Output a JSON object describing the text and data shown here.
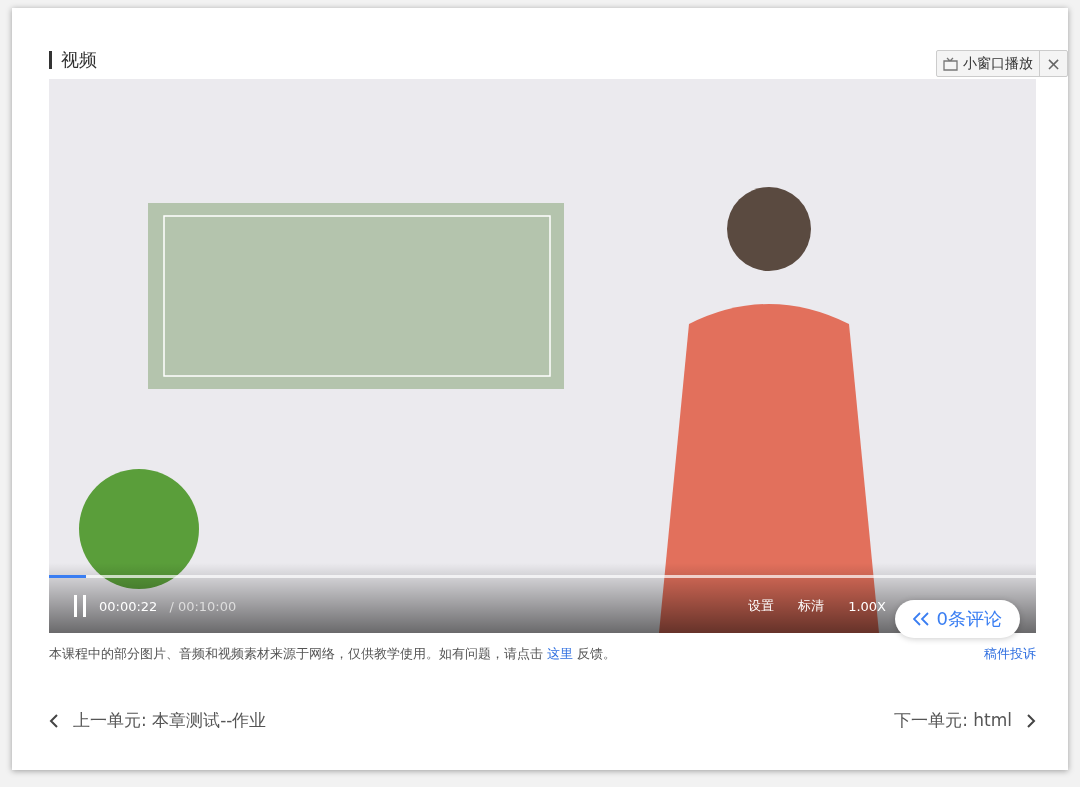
{
  "section_title": "视频",
  "mini_player": {
    "label": "小窗口播放",
    "close": "×"
  },
  "player": {
    "playing": true,
    "progress": {
      "level": 0.037
    },
    "current_time": "00:00:22",
    "duration": "/ 00:10:00",
    "settings": "设置",
    "quality": "标清",
    "speed": "1.00X"
  },
  "comments_button": {
    "label": "0条评论"
  },
  "notice": {
    "text_before": "本课程中的部分图片、音频和视频素材来源于网络，仅供教学使用。如有问题，请点击",
    "link": "这里",
    "text_after": "反馈。"
  },
  "report_link": "稿件投诉",
  "navigation": {
    "previous": {
      "label": "上一单元:",
      "title": "本章测试--作业"
    },
    "next": {
      "label": "下一单元:",
      "title": "html"
    }
  }
}
